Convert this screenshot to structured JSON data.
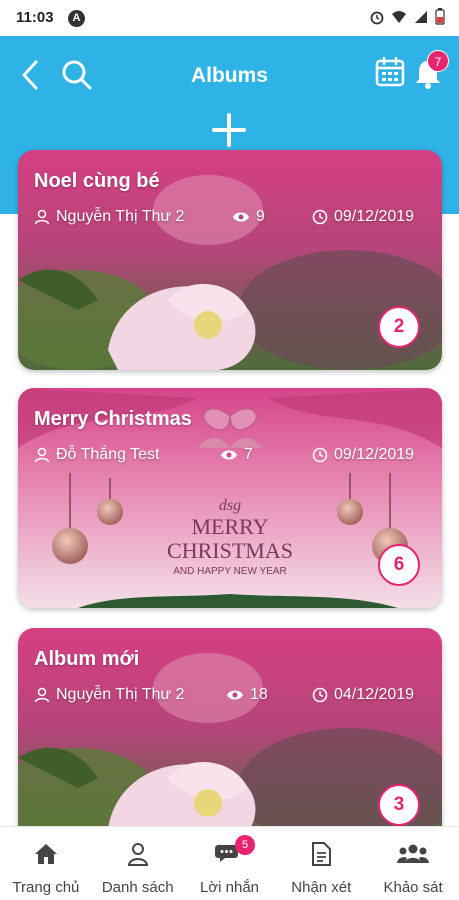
{
  "status_bar": {
    "time": "11:03",
    "a_badge": "A"
  },
  "header": {
    "title": "Albums",
    "notification_count": "7"
  },
  "colors": {
    "header": "#2fb3e6",
    "accent": "#e6246f",
    "card_pink": "#d8437f"
  },
  "albums": [
    {
      "title": "Noel cùng bé",
      "author": "Nguyễn Thị Thư 2",
      "views": "9",
      "date": "09/12/2019",
      "photo_count": "2"
    },
    {
      "title": "Merry Christmas",
      "author": "Đỗ Thắng Test",
      "views": "7",
      "date": "09/12/2019",
      "photo_count": "6",
      "image_text": {
        "logo": "dsg",
        "line1": "MERRY",
        "line2": "CHRISTMAS",
        "line3": "AND HAPPY NEW YEAR"
      }
    },
    {
      "title": "Album mới",
      "author": "Nguyễn Thị Thư 2",
      "views": "18",
      "date": "04/12/2019",
      "photo_count": "3"
    }
  ],
  "bottom_nav": {
    "items": [
      {
        "label": "Trang chủ",
        "icon": "home-icon"
      },
      {
        "label": "Danh sách",
        "icon": "person-icon"
      },
      {
        "label": "Lời nhắn",
        "icon": "chat-icon",
        "badge": "5"
      },
      {
        "label": "Nhận xét",
        "icon": "document-icon"
      },
      {
        "label": "Khảo sát",
        "icon": "group-icon"
      }
    ]
  }
}
